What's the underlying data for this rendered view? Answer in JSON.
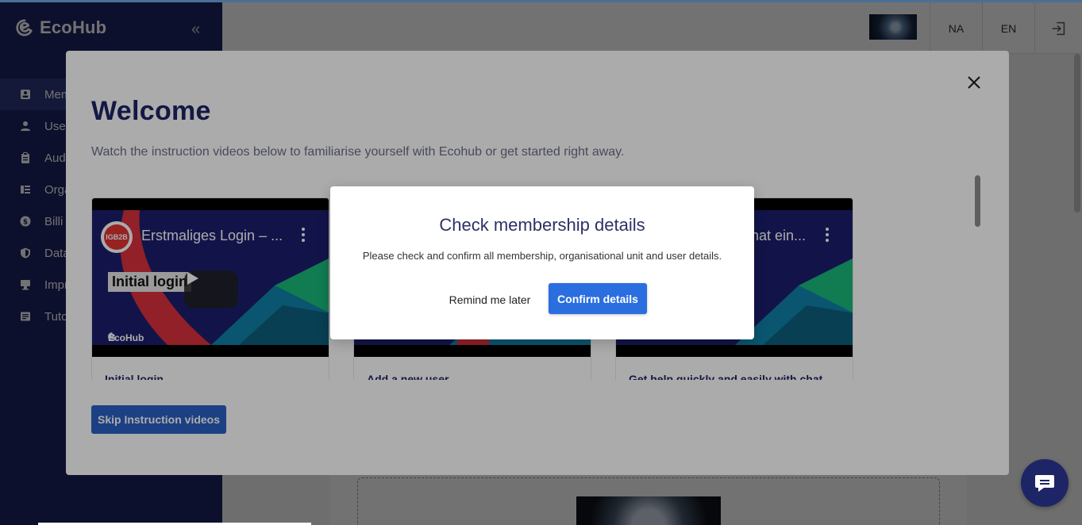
{
  "app": {
    "logo_text": "EcoHub",
    "collapse_glyph": "«"
  },
  "sidebar": {
    "items": [
      {
        "label": "Mem",
        "icon": "member-card-icon"
      },
      {
        "label": "Use",
        "icon": "user-icon"
      },
      {
        "label": "Aud",
        "icon": "clipboard-icon"
      },
      {
        "label": "Orga",
        "icon": "organisation-icon"
      },
      {
        "label": "Billi",
        "icon": "billing-icon"
      },
      {
        "label": "Data",
        "icon": "shield-icon"
      },
      {
        "label": "Impr",
        "icon": "imprint-icon"
      },
      {
        "label": "Tuto",
        "icon": "tutorial-icon"
      }
    ]
  },
  "topbar": {
    "na_label": "NA",
    "lang_label": "EN",
    "logout_icon": "logout-icon"
  },
  "welcome": {
    "title": "Welcome",
    "subtitle": "Watch the instruction videos below to familiarise yourself with Ecohub or get started right away.",
    "close_icon": "close-icon",
    "skip_label": "Skip Instruction videos",
    "videos": [
      {
        "title": "Erstmaliges Login – ...",
        "label": "Initial login",
        "brand": "EcoHub",
        "channel": "IGB2B",
        "caption": "Initial login"
      },
      {
        "caption": "Add a new user"
      },
      {
        "title": "hat ein...",
        "caption": "Get help quickly and easily with chat"
      }
    ]
  },
  "dialog": {
    "title": "Check membership details",
    "text": "Please check and confirm all membership, organisational unit and user details.",
    "remind_label": "Remind me later",
    "confirm_label": "Confirm details"
  },
  "colors": {
    "brand_navy": "#1d2566",
    "primary_blue": "#2a6ee0",
    "skip_blue": "#2a60c5"
  }
}
